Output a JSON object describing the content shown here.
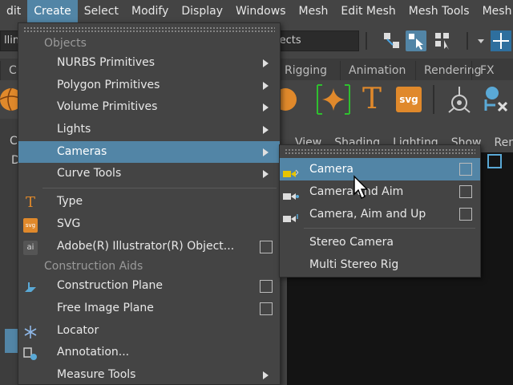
{
  "menubar": [
    "dit",
    "Create",
    "Select",
    "Modify",
    "Display",
    "Windows",
    "Mesh",
    "Edit Mesh",
    "Mesh Tools",
    "Mesh Display"
  ],
  "toolbar": {
    "left_field": "lling",
    "right_field": "jects"
  },
  "shelf_tabs": [
    "Cu",
    "Rigging",
    "Animation",
    "Rendering",
    "FX"
  ],
  "viewport_menu": [
    "View",
    "Shading",
    "Lighting",
    "Show",
    "Render"
  ],
  "left_panel": {
    "top_label": "C",
    "second_label": "D"
  },
  "create_menu": {
    "section_objects": "Objects",
    "objects_items": [
      {
        "label": "NURBS Primitives",
        "submenu": true
      },
      {
        "label": "Polygon Primitives",
        "submenu": true
      },
      {
        "label": "Volume Primitives",
        "submenu": true
      },
      {
        "label": "Lights",
        "submenu": true
      },
      {
        "label": "Cameras",
        "submenu": true,
        "highlighted": true
      },
      {
        "label": "Curve Tools",
        "submenu": true
      }
    ],
    "type_items": [
      {
        "label": "Type",
        "icon": "type-icon"
      },
      {
        "label": "SVG",
        "icon": "svg-icon"
      },
      {
        "label": "Adobe(R) Illustrator(R) Object...",
        "icon": "illustrator-icon",
        "option_box": true
      }
    ],
    "section_construction": "Construction Aids",
    "construction_items": [
      {
        "label": "Construction Plane",
        "icon": "construction-plane-icon",
        "option_box": true
      },
      {
        "label": "Free Image Plane",
        "option_box": true
      },
      {
        "label": "Locator",
        "icon": "locator-icon"
      },
      {
        "label": "Annotation...",
        "icon": "annotation-icon"
      },
      {
        "label": "Measure Tools",
        "submenu": true
      }
    ]
  },
  "cameras_submenu": {
    "items": [
      {
        "label": "Camera",
        "highlighted": true,
        "option_box": true
      },
      {
        "label": "Camera and Aim",
        "option_box": true
      },
      {
        "label": "Camera, Aim and Up",
        "option_box": true
      }
    ],
    "stereo_items": [
      "Stereo Camera",
      "Multi Stereo Rig"
    ]
  },
  "colors": {
    "highlight": "#5285a6",
    "menu_bg": "#444444",
    "accent_orange": "#e0892b",
    "accent_green": "#2fbf2f"
  }
}
